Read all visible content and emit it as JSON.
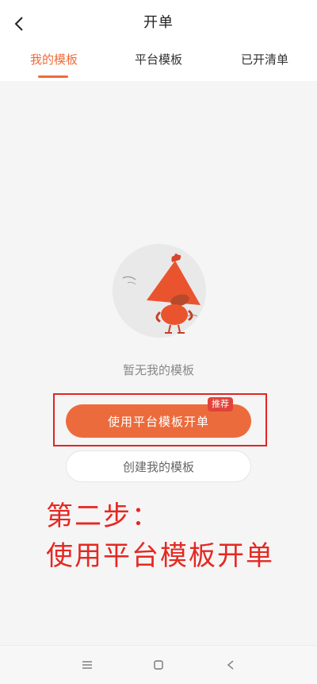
{
  "header": {
    "title": "开单",
    "back_icon": "chevron-left-icon"
  },
  "tabs": [
    {
      "label": "我的模板",
      "active": true
    },
    {
      "label": "平台模板",
      "active": false
    },
    {
      "label": "已开清单",
      "active": false
    }
  ],
  "empty_state": {
    "illustration": "mascot-illustration",
    "message": "暂无我的模板"
  },
  "actions": {
    "primary_label": "使用平台模板开单",
    "badge": "推荐",
    "secondary_label": "创建我的模板"
  },
  "annotation": {
    "line1": "第二步：",
    "line2": "使用平台模板开单"
  },
  "nav_bar": {
    "menu_icon": "menu-icon",
    "home_icon": "square-icon",
    "back_icon": "back-triangle-icon"
  },
  "colors": {
    "accent": "#ec6b3c",
    "annotation_red": "#e52822",
    "badge_red": "#e0433a"
  }
}
